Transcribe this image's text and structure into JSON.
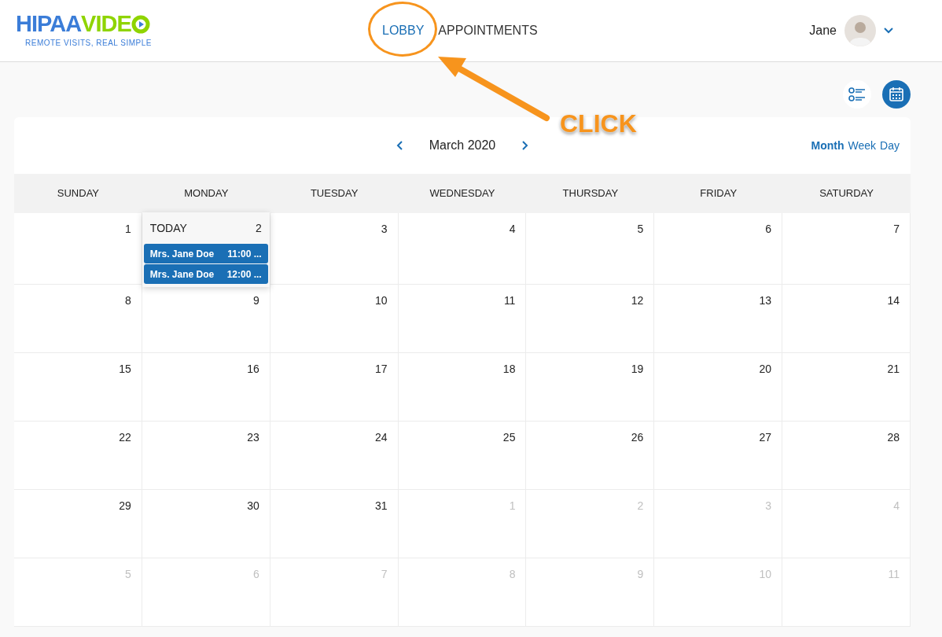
{
  "logo": {
    "part1": "HIPAA",
    "part2": "VIDE",
    "tagline": "REMOTE VISITS, REAL SIMPLE"
  },
  "nav": [
    {
      "label": "LOBBY",
      "selected": true
    },
    {
      "label": "APPOINTMENTS",
      "selected": false
    }
  ],
  "user": {
    "name": "Jane"
  },
  "view_toggle": [
    {
      "kind": "list",
      "selected": false
    },
    {
      "kind": "calendar",
      "selected": true
    }
  ],
  "calendar": {
    "month": "March 2020",
    "views": [
      {
        "label": "Month",
        "selected": true
      },
      {
        "label": "Week",
        "selected": false
      },
      {
        "label": "Day",
        "selected": false
      }
    ],
    "weekdays": [
      "SUNDAY",
      "MONDAY",
      "TUESDAY",
      "WEDNESDAY",
      "THURSDAY",
      "FRIDAY",
      "SATURDAY"
    ],
    "weeks": [
      [
        {
          "day": "1",
          "outside": false
        },
        {
          "day": "2",
          "outside": false,
          "today": true,
          "today_label": "TODAY",
          "events": [
            {
              "name": "Mrs. Jane Doe",
              "time": "11:00 ..."
            },
            {
              "name": "Mrs. Jane Doe",
              "time": "12:00 ..."
            }
          ]
        },
        {
          "day": "3",
          "outside": false
        },
        {
          "day": "4",
          "outside": false
        },
        {
          "day": "5",
          "outside": false
        },
        {
          "day": "6",
          "outside": false
        },
        {
          "day": "7",
          "outside": false
        }
      ],
      [
        {
          "day": "8",
          "outside": false
        },
        {
          "day": "9",
          "outside": false
        },
        {
          "day": "10",
          "outside": false
        },
        {
          "day": "11",
          "outside": false
        },
        {
          "day": "12",
          "outside": false
        },
        {
          "day": "13",
          "outside": false
        },
        {
          "day": "14",
          "outside": false
        }
      ],
      [
        {
          "day": "15",
          "outside": false
        },
        {
          "day": "16",
          "outside": false
        },
        {
          "day": "17",
          "outside": false
        },
        {
          "day": "18",
          "outside": false
        },
        {
          "day": "19",
          "outside": false
        },
        {
          "day": "20",
          "outside": false
        },
        {
          "day": "21",
          "outside": false
        }
      ],
      [
        {
          "day": "22",
          "outside": false
        },
        {
          "day": "23",
          "outside": false
        },
        {
          "day": "24",
          "outside": false
        },
        {
          "day": "25",
          "outside": false
        },
        {
          "day": "26",
          "outside": false
        },
        {
          "day": "27",
          "outside": false
        },
        {
          "day": "28",
          "outside": false
        }
      ],
      [
        {
          "day": "29",
          "outside": false
        },
        {
          "day": "30",
          "outside": false
        },
        {
          "day": "31",
          "outside": false
        },
        {
          "day": "1",
          "outside": true
        },
        {
          "day": "2",
          "outside": true
        },
        {
          "day": "3",
          "outside": true
        },
        {
          "day": "4",
          "outside": true
        }
      ],
      [
        {
          "day": "5",
          "outside": true
        },
        {
          "day": "6",
          "outside": true
        },
        {
          "day": "7",
          "outside": true
        },
        {
          "day": "8",
          "outside": true
        },
        {
          "day": "9",
          "outside": true
        },
        {
          "day": "10",
          "outside": true
        },
        {
          "day": "11",
          "outside": true
        }
      ]
    ]
  },
  "annotation": {
    "text": "CLICK"
  }
}
